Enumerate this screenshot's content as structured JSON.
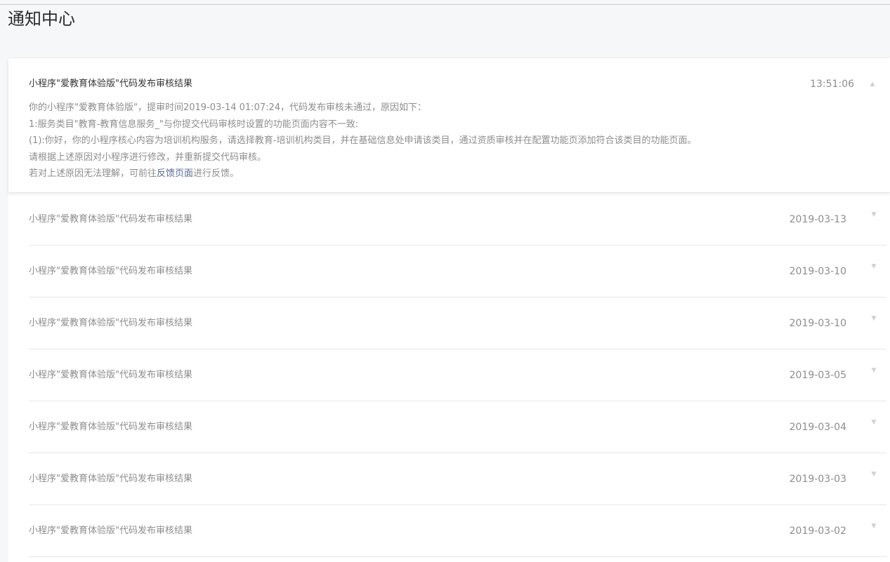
{
  "page": {
    "title": "通知中心"
  },
  "expanded_notice": {
    "title": "小程序\"爱教育体验版\"代码发布审核结果",
    "time": "13:51:06",
    "collapse_icon": "chevron-up-icon",
    "lines": [
      "你的小程序\"爱教育体验版\"，提审时间2019-03-14 01:07:24，代码发布审核未通过，原因如下：",
      "1:服务类目\"教育-教育信息服务_\"与你提交代码审核时设置的功能页面内容不一致:",
      "(1):你好，你的小程序核心内容为培训机构服务，请选择教育-培训机构类目，并在基础信息处申请该类目，通过资质审核并在配置功能页添加符合该类目的功能页面。",
      "请根据上述原因对小程序进行修改，并重新提交代码审核。"
    ],
    "last_line_prefix": "若对上述原因无法理解，可前往",
    "feedback_link": "反馈页面",
    "last_line_suffix": "进行反馈。"
  },
  "notices": [
    {
      "title": "小程序\"爱教育体验版\"代码发布审核结果",
      "date": "2019-03-13",
      "icon": "chevron-down-icon"
    },
    {
      "title": "小程序\"爱教育体验版\"代码发布审核结果",
      "date": "2019-03-10",
      "icon": "chevron-down-icon"
    },
    {
      "title": "小程序\"爱教育体验版\"代码发布审核结果",
      "date": "2019-03-10",
      "icon": "chevron-down-icon"
    },
    {
      "title": "小程序\"爱教育体验版\"代码发布审核结果",
      "date": "2019-03-05",
      "icon": "chevron-down-icon"
    },
    {
      "title": "小程序\"爱教育体验版\"代码发布审核结果",
      "date": "2019-03-04",
      "icon": "chevron-down-icon"
    },
    {
      "title": "小程序\"爱教育体验版\"代码发布审核结果",
      "date": "2019-03-03",
      "icon": "chevron-down-icon"
    },
    {
      "title": "小程序\"爱教育体验版\"代码发布审核结果",
      "date": "2019-03-02",
      "icon": "chevron-down-icon"
    }
  ]
}
